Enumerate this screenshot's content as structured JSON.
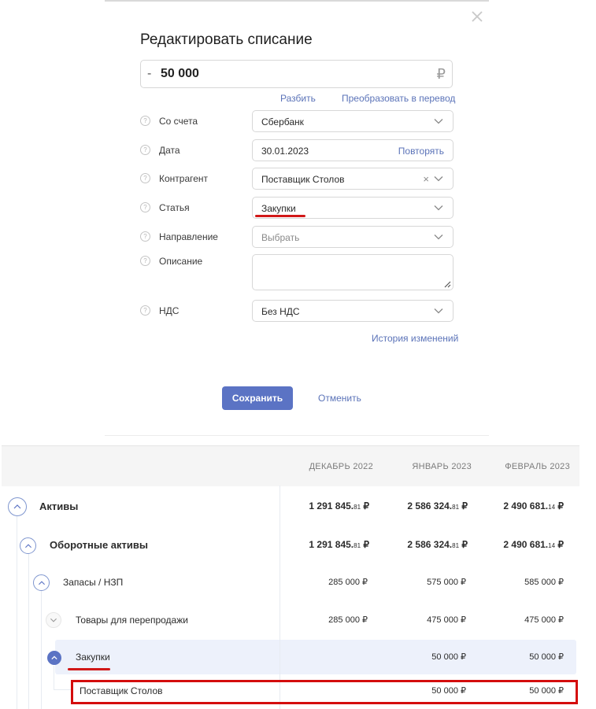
{
  "modal": {
    "title": "Редактировать списание",
    "amount": {
      "sign": "-",
      "value": "50 000",
      "currency": "₽"
    },
    "links": {
      "split": "Разбить",
      "convert": "Преобразовать в перевод"
    },
    "fields": {
      "account": {
        "label": "Со счета",
        "value": "Сбербанк"
      },
      "date": {
        "label": "Дата",
        "value": "30.01.2023",
        "repeat": "Повторять"
      },
      "counterparty": {
        "label": "Контрагент",
        "value": "Поставщик Столов",
        "clear": "×"
      },
      "article": {
        "label": "Статья",
        "value": "Закупки"
      },
      "direction": {
        "label": "Направление",
        "placeholder": "Выбрать"
      },
      "description": {
        "label": "Описание",
        "value": ""
      },
      "vat": {
        "label": "НДС",
        "value": "Без НДС"
      }
    },
    "history_link": "История изменений",
    "save_label": "Сохранить",
    "cancel_label": "Отменить",
    "help_glyph": "?"
  },
  "table": {
    "columns": [
      "ДЕКАБРЬ 2022",
      "ЯНВАРЬ 2023",
      "ФЕВРАЛЬ 2023"
    ],
    "rows": [
      {
        "label": "Активы",
        "bold": true,
        "values": [
          {
            "int": "1 291 845.",
            "dec": "81",
            "cur": " ₽"
          },
          {
            "int": "2 586 324.",
            "dec": "81",
            "cur": " ₽"
          },
          {
            "int": "2 490 681.",
            "dec": "14",
            "cur": " ₽"
          }
        ]
      },
      {
        "label": "Оборотные активы",
        "bold": true,
        "values": [
          {
            "int": "1 291 845.",
            "dec": "81",
            "cur": " ₽"
          },
          {
            "int": "2 586 324.",
            "dec": "81",
            "cur": " ₽"
          },
          {
            "int": "2 490 681.",
            "dec": "14",
            "cur": " ₽"
          }
        ]
      },
      {
        "label": "Запасы / НЗП",
        "values": [
          "285 000 ₽",
          "575 000 ₽",
          "585 000 ₽"
        ]
      },
      {
        "label": "Товары для перепродажи",
        "values": [
          "285 000 ₽",
          "475 000 ₽",
          "475 000 ₽"
        ]
      },
      {
        "label": "Закупки",
        "values": [
          "",
          "50 000 ₽",
          "50 000 ₽"
        ]
      },
      {
        "label": "Поставщик Столов",
        "values": [
          "",
          "50 000 ₽",
          "50 000 ₽"
        ]
      }
    ]
  },
  "colors": {
    "accent": "#5b73c4",
    "link": "#5b73b8",
    "highlight_red": "#d40d0d",
    "row_highlight": "#edf1fb"
  }
}
